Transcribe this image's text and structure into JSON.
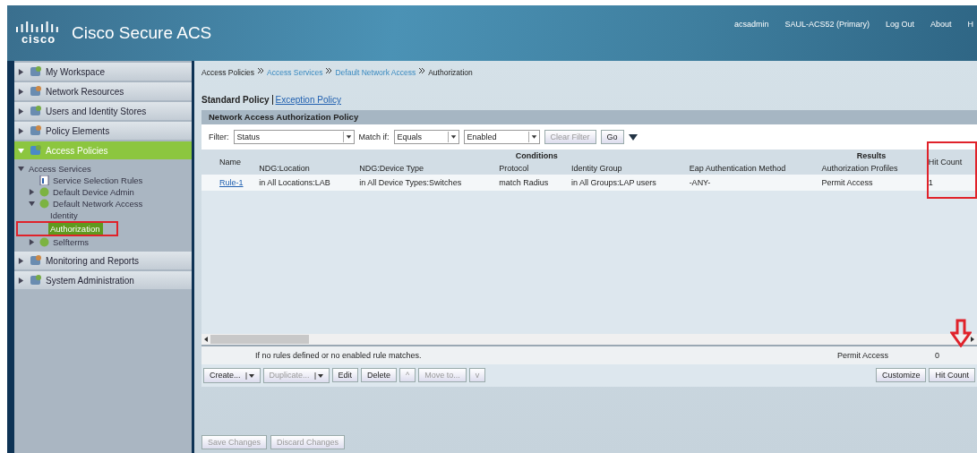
{
  "header": {
    "logo": "cisco",
    "title": "Cisco Secure ACS",
    "links": [
      "acsadmin",
      "SAUL-ACS52 (Primary)",
      "Log Out",
      "About",
      "H"
    ]
  },
  "sidebar": {
    "items": [
      {
        "label": "My Workspace",
        "selected": false,
        "expanded": false
      },
      {
        "label": "Network Resources",
        "selected": false,
        "expanded": false
      },
      {
        "label": "Users and Identity Stores",
        "selected": false,
        "expanded": false
      },
      {
        "label": "Policy Elements",
        "selected": false,
        "expanded": false
      },
      {
        "label": "Access Policies",
        "selected": true,
        "expanded": true,
        "children": [
          {
            "label": "Access Services",
            "selected": false,
            "expanded": true,
            "children": [
              {
                "label": "Service Selection Rules",
                "selected": false
              },
              {
                "label": "Default Device Admin",
                "selected": false,
                "expanded": false
              },
              {
                "label": "Default Network Access",
                "selected": false,
                "expanded": true,
                "children": [
                  {
                    "label": "Identity",
                    "selected": false
                  },
                  {
                    "label": "Authorization",
                    "selected": true
                  }
                ]
              },
              {
                "label": "Selfterms",
                "selected": false,
                "expanded": false
              }
            ]
          }
        ]
      },
      {
        "label": "Monitoring and Reports",
        "selected": false,
        "expanded": false
      },
      {
        "label": "System Administration",
        "selected": false,
        "expanded": false
      }
    ]
  },
  "breadcrumb": [
    {
      "label": "Access Policies",
      "link": false
    },
    {
      "label": "Access Services",
      "link": true
    },
    {
      "label": "Default Network Access",
      "link": true
    },
    {
      "label": "Authorization",
      "link": false
    }
  ],
  "policy_tabs": [
    {
      "label": "Standard Policy",
      "selected": true
    },
    {
      "label": "Exception Policy",
      "selected": false
    }
  ],
  "panel_title": "Network Access Authorization Policy",
  "filter": {
    "label": "Filter:",
    "field": "Status",
    "match_label": "Match if:",
    "operator": "Equals",
    "value": "Enabled",
    "clear": "Clear Filter",
    "go": "Go"
  },
  "table": {
    "groups": [
      {
        "label": "Conditions"
      },
      {
        "label": "Results"
      }
    ],
    "columns": [
      "Name",
      "NDG:Location",
      "NDG:Device Type",
      "Protocol",
      "Identity Group",
      "Eap Authentication Method",
      "Authorization Profiles",
      "Hit Count"
    ],
    "rows": [
      {
        "cells": [
          "Rule-1",
          "in All Locations:LAB",
          "in All Device Types:Switches",
          "match Radius",
          "in All Groups:LAP users",
          "-ANY-",
          "Permit Access",
          "1"
        ]
      }
    ],
    "default_row": {
      "text": "If no rules defined or no enabled rule matches.",
      "profile": "Permit Access",
      "hits": "0"
    }
  },
  "actions": [
    {
      "label": "Create...",
      "dropdown": true,
      "disabled": false
    },
    {
      "label": "Duplicate...",
      "dropdown": true,
      "disabled": true
    },
    {
      "label": "Edit",
      "dropdown": false,
      "disabled": false
    },
    {
      "label": "Delete",
      "dropdown": false,
      "disabled": false
    },
    {
      "label": "^",
      "dropdown": false,
      "disabled": true
    },
    {
      "label": "Move to...",
      "dropdown": false,
      "disabled": true
    },
    {
      "label": "v",
      "dropdown": false,
      "disabled": true
    }
  ],
  "right_actions": [
    "Customize",
    "Hit Count"
  ],
  "footer_buttons": [
    {
      "label": "Save Changes",
      "disabled": true
    },
    {
      "label": "Discard Changes",
      "disabled": true
    }
  ]
}
